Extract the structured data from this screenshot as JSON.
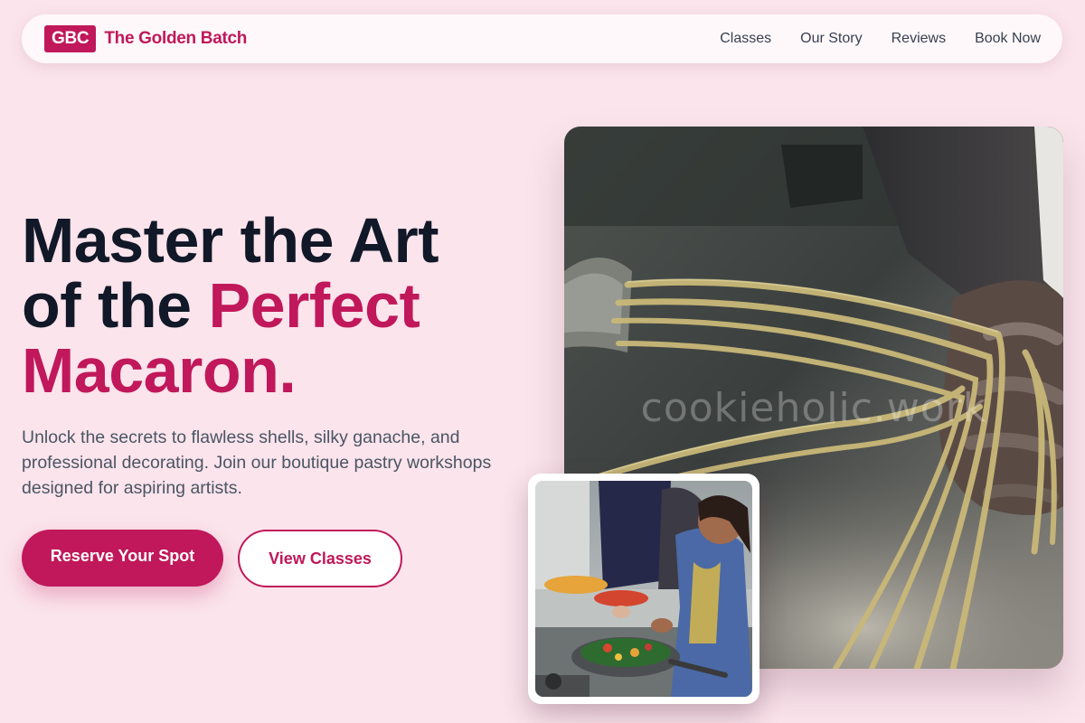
{
  "nav": {
    "logo_badge": "GBC",
    "brand_name": "The Golden Batch",
    "links": [
      {
        "label": "Classes"
      },
      {
        "label": "Our Story"
      },
      {
        "label": "Reviews"
      },
      {
        "label": "Book Now"
      }
    ]
  },
  "hero": {
    "title_line1": "Master the Art",
    "title_line2_prefix": "of the ",
    "title_accent_1": "Perfect",
    "title_accent_2": "Macaron.",
    "subtitle": "Unlock the secrets to flawless shells, silky ganache, and professional decorating. Join our boutique pastry workshops designed for aspiring artists.",
    "primary_cta": "Reserve Your Spot",
    "secondary_cta": "View Classes"
  },
  "media": {
    "main_image_watermark": "cookieholic.work",
    "main_image_subject": "hands-holding-fresh-pasta",
    "inset_image_subject": "people-cooking-vegetables-in-pan"
  },
  "colors": {
    "background": "#fbe4ec",
    "accent": "#c0185a",
    "heading": "#111827",
    "body_text": "#4b5563",
    "nav_bg": "#fff8fa"
  }
}
